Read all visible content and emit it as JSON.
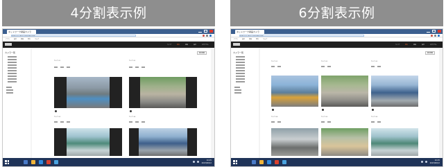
{
  "left_panel": {
    "banner": "4分割表示例",
    "browser": {
      "tab_title": "ネットワーク録画カメラ",
      "address": "http://192.168.0.1/live/index.html"
    },
    "bookmarks": [
      "アプリ",
      "設定",
      "録画",
      "再生",
      "ヘルプ"
    ],
    "app_menu": [
      "ライブ",
      "再生",
      "録画",
      "設定",
      "ログアウト"
    ],
    "sidebar_title": "カメラ一覧",
    "content_button": "表示切替",
    "camera_labels": [
      "カメラ 01",
      "カメラ 02",
      "カメラ 03",
      "カメラ 04"
    ],
    "clock": [
      "10:25",
      "2023/06/12"
    ]
  },
  "right_panel": {
    "banner": "6分割表示例",
    "browser": {
      "tab_title": "ネットワーク録画カメラ",
      "address": "http://192.168.0.1/live/index.html"
    },
    "bookmarks": [
      "アプリ",
      "設定",
      "録画",
      "再生",
      "ヘルプ"
    ],
    "app_menu": [
      "ライブ",
      "再生",
      "録画",
      "設定",
      "ログアウト"
    ],
    "sidebar_title": "カメラ一覧",
    "content_button": "表示切替",
    "camera_labels": [
      "カメラ 01",
      "カメラ 02",
      "カメラ 03",
      "カメラ 04",
      "カメラ 05",
      "カメラ 06"
    ],
    "clock": [
      "10:25",
      "2023/06/12"
    ]
  },
  "colors": {
    "banner": "#8e8e8e",
    "tabbar": "#3b5f8f",
    "app_header": "#1e1e1e",
    "menu_active": "#ff6a2d",
    "taskbar": "#1f3358"
  }
}
